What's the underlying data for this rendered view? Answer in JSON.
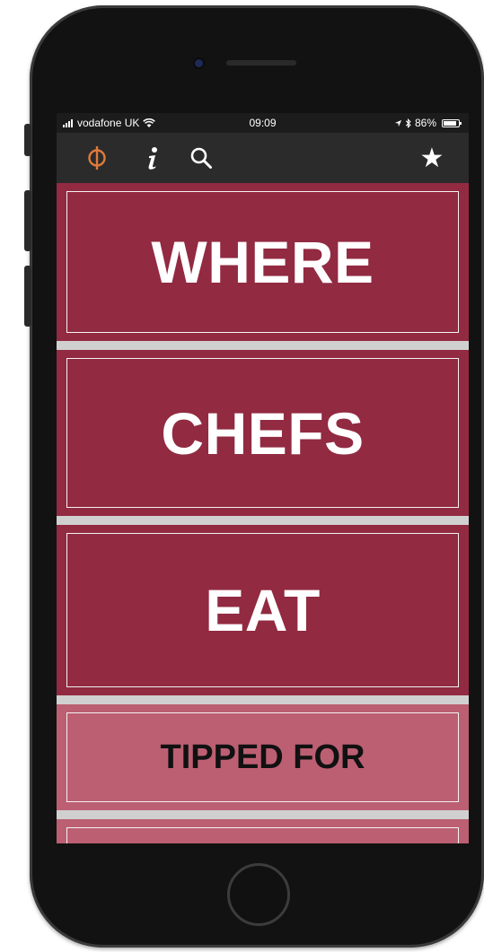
{
  "status_bar": {
    "carrier": "vodafone UK",
    "time": "09:09",
    "battery_percent": "86%",
    "battery_level": 0.86
  },
  "toolbar": {
    "icons": [
      "phi-logo-icon",
      "info-icon",
      "search-icon",
      "star-icon"
    ]
  },
  "menu": {
    "items": [
      {
        "label": "WHERE"
      },
      {
        "label": "CHEFS"
      },
      {
        "label": "EAT"
      },
      {
        "label": "TIPPED FOR"
      },
      {
        "label": ""
      }
    ]
  },
  "colors": {
    "primary_panel": "#922a41",
    "secondary_panel": "#bc5f72",
    "logo_accent": "#e07a3a",
    "toolbar": "#2b2b2b"
  }
}
